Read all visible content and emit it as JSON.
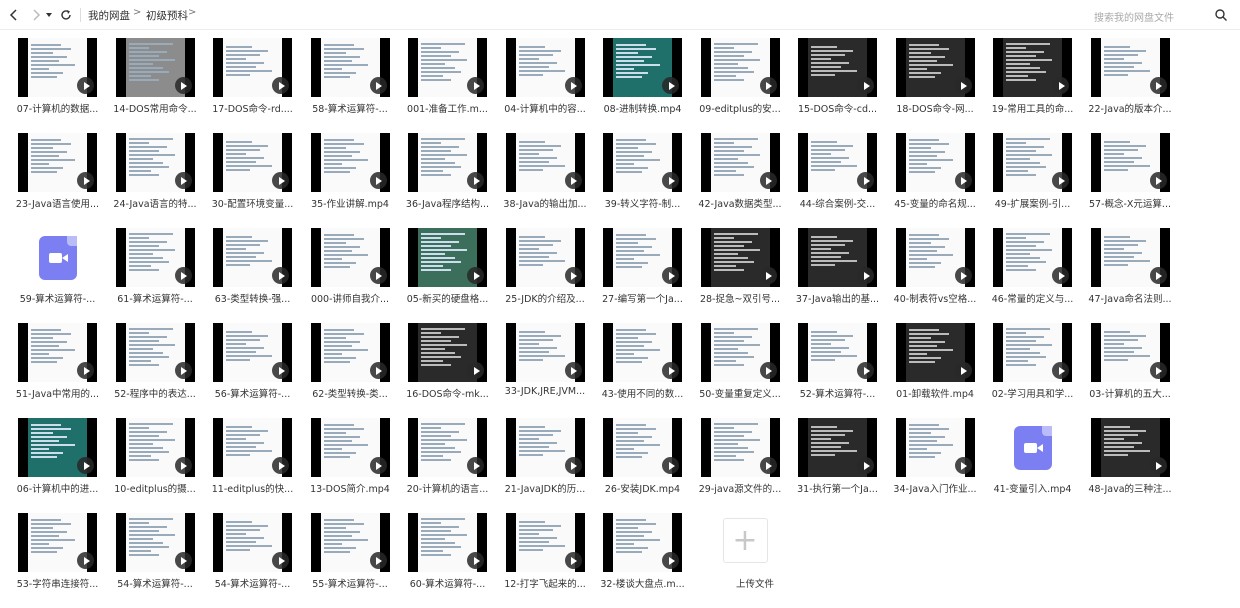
{
  "breadcrumb": {
    "root": "我的网盘",
    "folder": "初级预科",
    "sep1": ">",
    "sep2": ">"
  },
  "search": {
    "placeholder": "搜索我的网盘文件",
    "icon": "search-icon"
  },
  "nav": {
    "back_icon": "chevron-left-icon",
    "forward_icon": "chevron-right-icon",
    "dropdown_icon": "caret-down-icon",
    "refresh_icon": "refresh-icon"
  },
  "files": [
    {
      "name": "07-计算机的数据...",
      "thumb": "light"
    },
    {
      "name": "14-DOS常用命令...",
      "thumb": "gray"
    },
    {
      "name": "17-DOS命令-rd....",
      "thumb": "light"
    },
    {
      "name": "58-算术运算符-...",
      "thumb": "light"
    },
    {
      "name": "001-准备工作.m...",
      "thumb": "light"
    },
    {
      "name": "04-计算机中的容...",
      "thumb": "light"
    },
    {
      "name": "08-进制转换.mp4",
      "thumb": "teal"
    },
    {
      "name": "09-editplus的安...",
      "thumb": "light"
    },
    {
      "name": "15-DOS命令-cd...",
      "thumb": "dark"
    },
    {
      "name": "18-DOS命令-网...",
      "thumb": "dark"
    },
    {
      "name": "19-常用工具的命...",
      "thumb": "dark"
    },
    {
      "name": "22-Java的版本介...",
      "thumb": "light"
    },
    {
      "name": "23-Java语言使用...",
      "thumb": "light"
    },
    {
      "name": "24-Java语言的特...",
      "thumb": "light"
    },
    {
      "name": "30-配置环境变量...",
      "thumb": "light"
    },
    {
      "name": "35-作业讲解.mp4",
      "thumb": "light"
    },
    {
      "name": "36-Java程序结构...",
      "thumb": "light"
    },
    {
      "name": "38-Java的输出加...",
      "thumb": "light"
    },
    {
      "name": "39-转义字符-制...",
      "thumb": "light"
    },
    {
      "name": "42-Java数据类型...",
      "thumb": "light"
    },
    {
      "name": "44-综合案例-交...",
      "thumb": "light"
    },
    {
      "name": "45-变量的命名规...",
      "thumb": "light"
    },
    {
      "name": "49-扩展案例-引...",
      "thumb": "light"
    },
    {
      "name": "57-概念-X元运算...",
      "thumb": "light"
    },
    {
      "name": "59-算术运算符-...",
      "thumb": "icon"
    },
    {
      "name": "61-算术运算符-...",
      "thumb": "light"
    },
    {
      "name": "63-类型转换-强...",
      "thumb": "light"
    },
    {
      "name": "000-讲师自我介...",
      "thumb": "light"
    },
    {
      "name": "05-新买的硬盘格...",
      "thumb": "green"
    },
    {
      "name": "25-JDK的介绍及...",
      "thumb": "light"
    },
    {
      "name": "27-编写第一个Ja...",
      "thumb": "light"
    },
    {
      "name": "28-捉急~双引号...",
      "thumb": "dark"
    },
    {
      "name": "37-Java输出的基...",
      "thumb": "dark"
    },
    {
      "name": "40-制表符vs空格...",
      "thumb": "light"
    },
    {
      "name": "46-常量的定义与...",
      "thumb": "light"
    },
    {
      "name": "47-Java命名法则...",
      "thumb": "light"
    },
    {
      "name": "51-Java中常用的...",
      "thumb": "light"
    },
    {
      "name": "52-程序中的表达...",
      "thumb": "light"
    },
    {
      "name": "56-算术运算符-...",
      "thumb": "light"
    },
    {
      "name": "62-类型转换-类...",
      "thumb": "light"
    },
    {
      "name": "16-DOS命令-mk...",
      "thumb": "dark"
    },
    {
      "name": "33-JDK,JRE,JVM...",
      "thumb": "light"
    },
    {
      "name": "43-使用不同的数...",
      "thumb": "light"
    },
    {
      "name": "50-变量重复定义...",
      "thumb": "light"
    },
    {
      "name": "52-算术运算符-...",
      "thumb": "light"
    },
    {
      "name": "01-卸载软件.mp4",
      "thumb": "dark"
    },
    {
      "name": "02-学习用具和学...",
      "thumb": "light"
    },
    {
      "name": "03-计算机的五大...",
      "thumb": "light"
    },
    {
      "name": "06-计算机中的进...",
      "thumb": "teal"
    },
    {
      "name": "10-editplus的摄...",
      "thumb": "light"
    },
    {
      "name": "11-editplus的快...",
      "thumb": "light"
    },
    {
      "name": "13-DOS简介.mp4",
      "thumb": "light"
    },
    {
      "name": "20-计算机的语言...",
      "thumb": "light"
    },
    {
      "name": "21-JavaJDK的历...",
      "thumb": "light"
    },
    {
      "name": "26-安装JDK.mp4",
      "thumb": "light"
    },
    {
      "name": "29-java源文件的...",
      "thumb": "light"
    },
    {
      "name": "31-执行第一个Ja...",
      "thumb": "dark"
    },
    {
      "name": "34-Java入门作业...",
      "thumb": "light"
    },
    {
      "name": "41-变量引入.mp4",
      "thumb": "icon"
    },
    {
      "name": "48-Java的三种注...",
      "thumb": "dark"
    },
    {
      "name": "53-字符串连接符...",
      "thumb": "light"
    },
    {
      "name": "54-算术运算符-...",
      "thumb": "light"
    },
    {
      "name": "54-算术运算符-...",
      "thumb": "light"
    },
    {
      "name": "55-算术运算符-...",
      "thumb": "light"
    },
    {
      "name": "60-算术运算符-...",
      "thumb": "light"
    },
    {
      "name": "12-打字飞起来的...",
      "thumb": "light"
    },
    {
      "name": "32-楼谈大盘点.m...",
      "thumb": "light"
    }
  ],
  "upload": {
    "label": "上传文件",
    "icon": "plus-icon"
  }
}
